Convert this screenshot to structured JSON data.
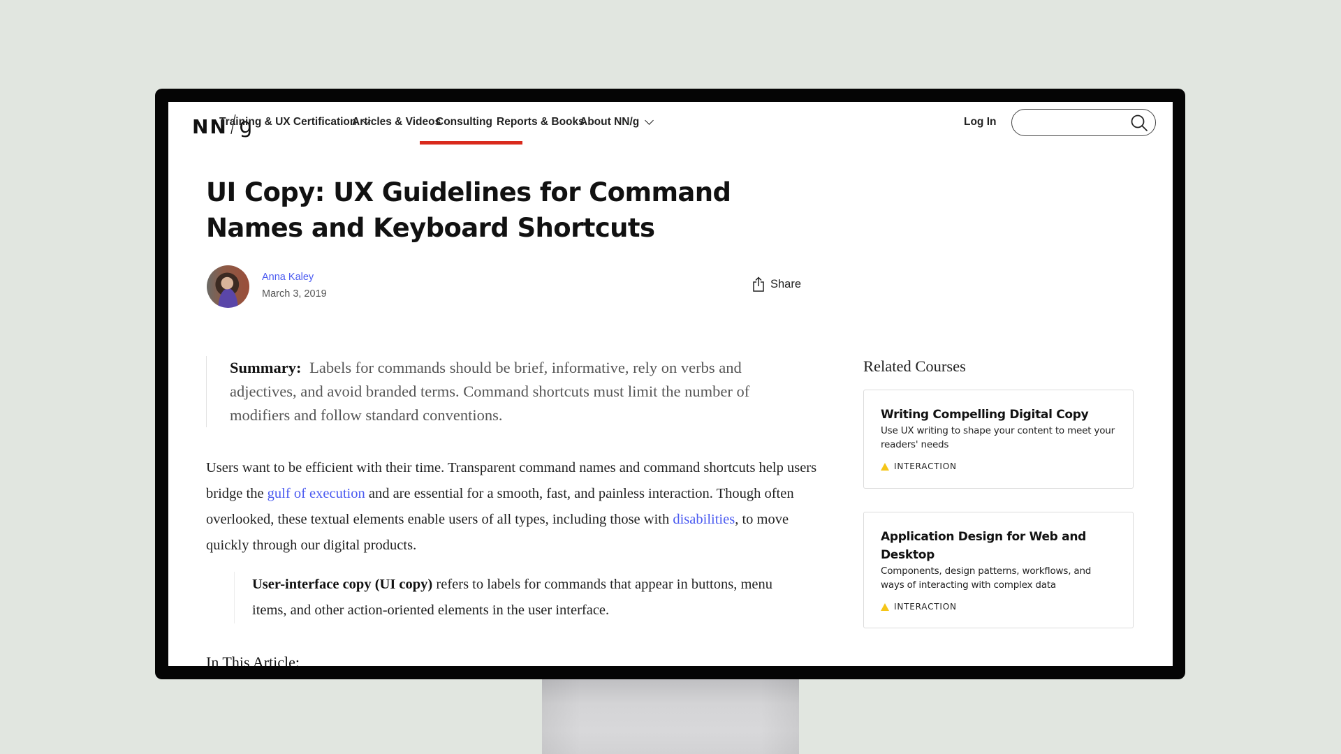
{
  "nav": {
    "logo": {
      "nn": "NN",
      "slash": "/",
      "g": "g"
    },
    "items": [
      {
        "label": "Training & UX Certification",
        "has_dropdown": true,
        "active": false
      },
      {
        "label": "Articles & Videos",
        "has_dropdown": false,
        "active": true
      },
      {
        "label": "Consulting",
        "has_dropdown": false,
        "active": false
      },
      {
        "label": "Reports & Books",
        "has_dropdown": false,
        "active": false
      },
      {
        "label": "About NN/g",
        "has_dropdown": true,
        "active": false
      }
    ],
    "login_label": "Log In",
    "search": {
      "value": "",
      "placeholder": "",
      "icon": "search-icon"
    },
    "active_color": "#d92a1c"
  },
  "article": {
    "title": "UI Copy: UX Guidelines for Command Names and Keyboard Shortcuts",
    "author": "Anna Kaley",
    "date": "March 3, 2019",
    "share_label": "Share",
    "summary_label": "Summary:",
    "summary_text": "Labels for commands should be brief, informative, rely on verbs and adjectives, and avoid branded terms. Command shortcuts must limit the number of modifiers and follow standard conventions.",
    "para1": {
      "t1": "Users want to be efficient with their time. Transparent command names and command shortcuts help users bridge the ",
      "link1": "gulf of execution",
      "t2": " and are essential for a smooth, fast, and painless interaction. Though often overlooked, these textual elements enable users of all types, including those with ",
      "link2": "disabilities",
      "t3": ", to move quickly through our digital products."
    },
    "definition": {
      "term": "User-interface copy (UI copy)",
      "text": " refers to labels for commands that appear in buttons, menu items, and other action-oriented elements in the user interface."
    },
    "toc_heading": "In This Article:"
  },
  "sidebar": {
    "heading": "Related Courses",
    "courses": [
      {
        "title": "Writing Compelling Digital Copy",
        "description": "Use UX writing to shape your content to meet your readers' needs",
        "tag": "INTERACTION"
      },
      {
        "title": "Application Design for Web and Desktop",
        "description": "Components, design patterns, workflows, and ways of interacting with complex data",
        "tag": "INTERACTION"
      }
    ],
    "tag_color": "#f5c518"
  },
  "colors": {
    "link": "#4a5af0",
    "background": "#e1e6e0"
  }
}
